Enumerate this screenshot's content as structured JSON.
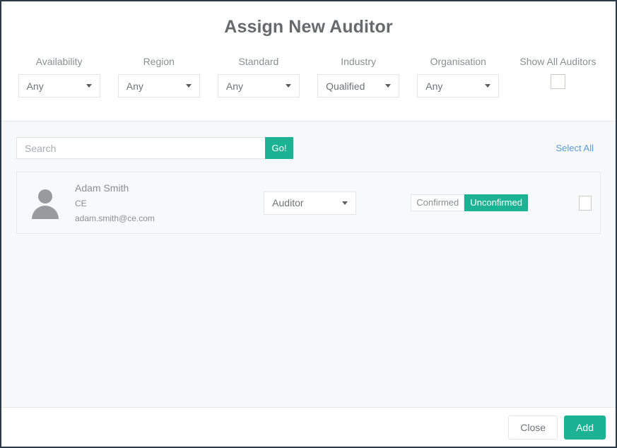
{
  "dialog": {
    "title": "Assign New Auditor"
  },
  "filters": [
    {
      "label": "Availability",
      "value": "Any",
      "name": "availability"
    },
    {
      "label": "Region",
      "value": "Any",
      "name": "region"
    },
    {
      "label": "Standard",
      "value": "Any",
      "name": "standard"
    },
    {
      "label": "Industry",
      "value": "Qualified",
      "name": "industry"
    },
    {
      "label": "Organisation",
      "value": "Any",
      "name": "organisation"
    }
  ],
  "show_all": {
    "label": "Show All Auditors",
    "checked": false
  },
  "search": {
    "placeholder": "Search",
    "value": "",
    "go_label": "Go!"
  },
  "select_all": {
    "label": "Select All"
  },
  "auditors": [
    {
      "name": "Adam Smith",
      "organisation": "CE",
      "email": "adam.smith@ce.com",
      "role": "Auditor",
      "confirmed_label": "Confirmed",
      "unconfirmed_label": "Unconfirmed",
      "status": "Unconfirmed",
      "selected": false
    }
  ],
  "footer": {
    "close_label": "Close",
    "add_label": "Add"
  },
  "colors": {
    "accent_green": "#1bb394",
    "link_blue": "#5b9bd5",
    "text_gray": "#8a8f94",
    "title_gray": "#676a6c",
    "body_bg": "#f7f8fa",
    "border": "#e7eaec",
    "dialog_border": "#2b3a46"
  }
}
